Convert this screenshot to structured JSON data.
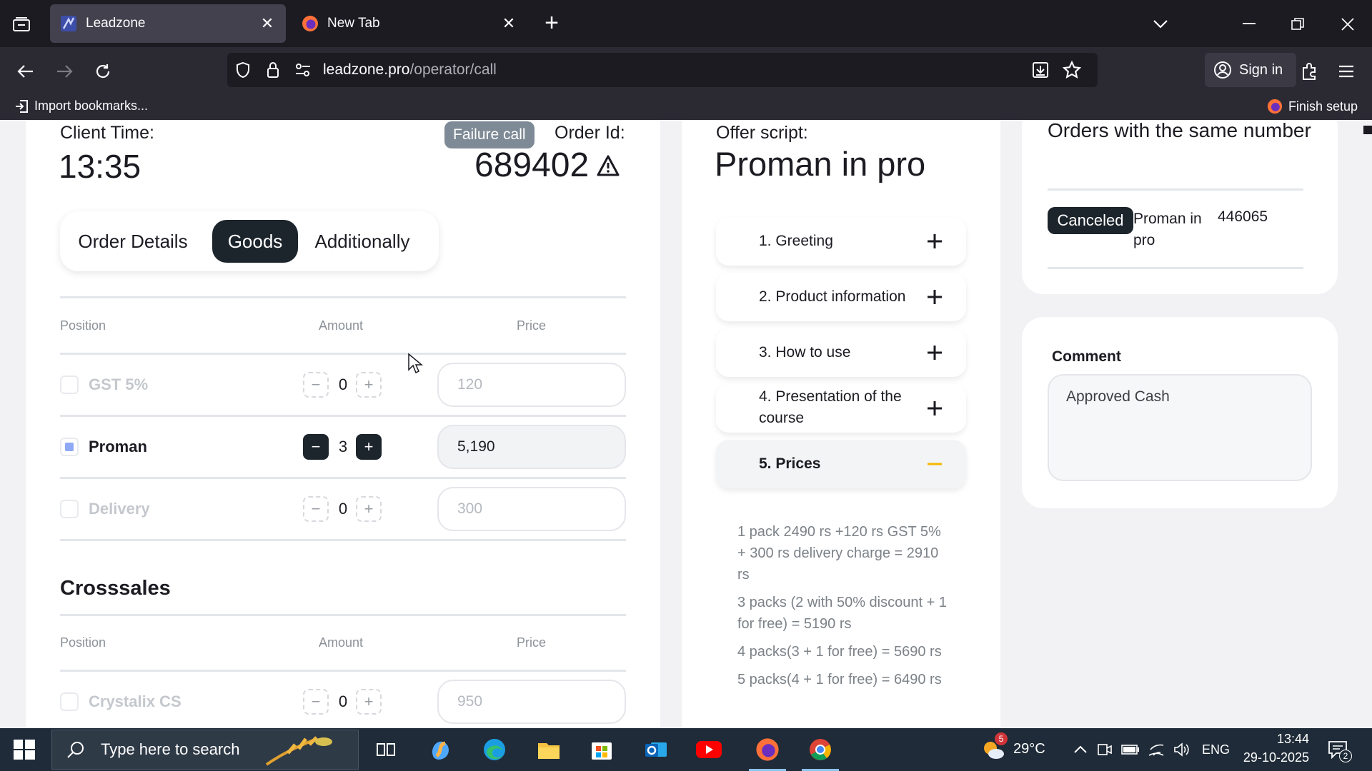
{
  "browser": {
    "tabs": [
      {
        "title": "Leadzone",
        "active": true
      },
      {
        "title": "New Tab",
        "active": false
      }
    ],
    "url_domain": "leadzone.pro",
    "url_path": "/operator/call",
    "sign_in_label": "Sign in",
    "bookmarks": {
      "import_label": "Import bookmarks...",
      "finish_setup_label": "Finish setup"
    }
  },
  "order_panel": {
    "client_time_label": "Client Time:",
    "client_time_value": "13:35",
    "failure_badge": "Failure call",
    "order_id_label": "Order Id:",
    "order_id_value": "689402",
    "tabs": [
      "Order Details",
      "Goods",
      "Additionally"
    ],
    "active_tab": "Goods",
    "goods_headers": {
      "position": "Position",
      "amount": "Amount",
      "price": "Price"
    },
    "goods_rows": [
      {
        "name": "GST 5%",
        "qty": "0",
        "price": "120",
        "checked": false
      },
      {
        "name": "Proman",
        "qty": "3",
        "price": "5,190",
        "checked": true
      },
      {
        "name": "Delivery",
        "qty": "0",
        "price": "300",
        "checked": false
      }
    ],
    "crosssales_title": "Crosssales",
    "crosssales_headers": {
      "position": "Position",
      "amount": "Amount",
      "price": "Price"
    },
    "crosssales_rows": [
      {
        "name": "Crystalix CS",
        "qty": "0",
        "price": "950",
        "checked": false
      }
    ],
    "stepper_minus": "−",
    "stepper_plus": "+"
  },
  "offer_script": {
    "label": "Offer script:",
    "product": "Proman in pro",
    "sections": [
      "1. Greeting",
      "2. Product information",
      "3. How to use",
      "4. Presentation of the course",
      "5. Prices"
    ],
    "open_section": "5. Prices",
    "prices_text": [
      "1 pack 2490 rs +120 rs GST 5% + 300 rs delivery charge = 2910 rs",
      "3 packs (2 with 50% discount + 1 for free) = 5190 rs",
      "4 packs(3 + 1 for free) = 5690 rs",
      "5 packs(4 + 1 for free) = 6490 rs"
    ]
  },
  "same_number_orders": {
    "title": "Orders with the same number",
    "orders": [
      {
        "status": "Canceled",
        "product": "Proman in pro",
        "order_id": "446065"
      }
    ]
  },
  "comment": {
    "label": "Comment",
    "value": "Approved Cash"
  },
  "taskbar": {
    "search_placeholder": "Type here to search",
    "weather_badge": "5",
    "temperature": "29°C",
    "language": "ENG",
    "time": "13:44",
    "date": "29-10-2025",
    "notifications": "2"
  },
  "colors": {
    "accent_dark": "#1c242c",
    "checkbox_fill": "#8ea9f5",
    "failure_badge": "#7e8a95",
    "accordion_minus": "#f5b700"
  }
}
